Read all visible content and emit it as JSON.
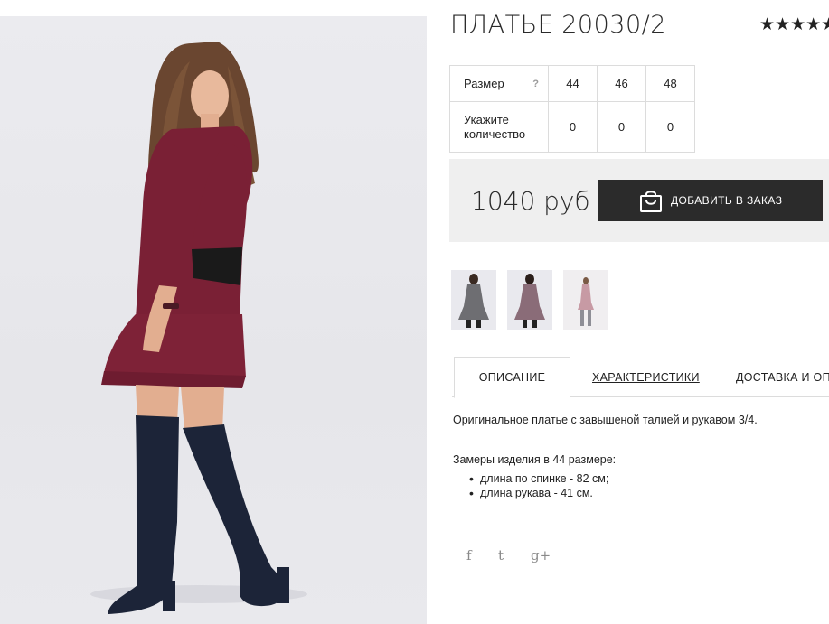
{
  "product": {
    "title": "ПЛАТЬЕ 20030/2",
    "rating_stars": "★★★★★"
  },
  "sizes": {
    "size_label": "Размер",
    "help_icon": "?",
    "quantity_label": "Укажите количество",
    "columns": [
      {
        "size": "44",
        "qty": "0"
      },
      {
        "size": "46",
        "qty": "0"
      },
      {
        "size": "48",
        "qty": "0"
      }
    ]
  },
  "buy": {
    "price": "1040 руб",
    "add_button_label": "ДОБАВИТЬ В ЗАКАЗ",
    "add_button_icon": "shopping-bag-icon"
  },
  "thumbnails": [
    {
      "name": "thumbnail-grey-dress",
      "color": "#6e6e72"
    },
    {
      "name": "thumbnail-mauve-dress",
      "color": "#8a6c78"
    },
    {
      "name": "thumbnail-pink-dress",
      "color": "#c79aa4"
    }
  ],
  "tabs": [
    {
      "label": "ОПИСАНИЕ"
    },
    {
      "label": "ХАРАКТЕРИСТИКИ"
    },
    {
      "label": "ДОСТАВКА И ОПЛ"
    }
  ],
  "description": {
    "intro": "Оригинальное платье с завышеной талией и рукавом 3/4.",
    "measures_heading": "Замеры изделия в 44 размере:",
    "measures": [
      "длина по спинке - 82 см;",
      "длина рукава - 41 см."
    ]
  },
  "social": {
    "facebook": "f",
    "twitter": "t",
    "google": "g+"
  },
  "colors": {
    "dress": "#7a2035",
    "boots": "#1c2438",
    "button": "#2b2b2b",
    "buybar": "#efefef"
  }
}
